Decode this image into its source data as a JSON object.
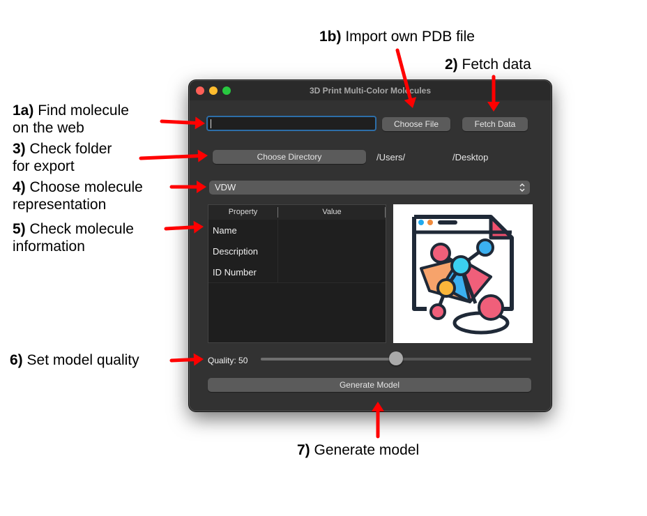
{
  "annotations": {
    "a1a_num": "1a)",
    "a1a_l1": "Find molecule",
    "a1a_l2": "on the web",
    "a1b_num": "1b)",
    "a1b_text": "Import own PDB file",
    "a2_num": "2)",
    "a2_text": "Fetch data",
    "a3_num": "3)",
    "a3_l1": "Check folder",
    "a3_l2": "for export",
    "a4_num": "4)",
    "a4_l1": "Choose molecule",
    "a4_l2": "representation",
    "a5_num": "5)",
    "a5_l1": "Check molecule",
    "a5_l2": "information",
    "a6_num": "6)",
    "a6_text": "Set model quality",
    "a7_num": "7)",
    "a7_text": "Generate model",
    "arrow_color": "#ff0000"
  },
  "window": {
    "title": "3D Print Multi-Color Molecules",
    "search_value": "",
    "choose_file_label": "Choose File",
    "fetch_data_label": "Fetch Data",
    "choose_directory_label": "Choose Directory",
    "path_prefix": "/Users/",
    "path_suffix": "/Desktop",
    "representation_selected": "VDW",
    "table": {
      "headers": [
        "Property",
        "Value"
      ],
      "rows": [
        {
          "property": "Name",
          "value": ""
        },
        {
          "property": "Description",
          "value": ""
        },
        {
          "property": "ID Number",
          "value": ""
        }
      ]
    },
    "quality_label": "Quality: 50",
    "quality_value": 50,
    "quality_max": 100,
    "generate_label": "Generate Model",
    "accent_color": "#2d6ea8"
  }
}
